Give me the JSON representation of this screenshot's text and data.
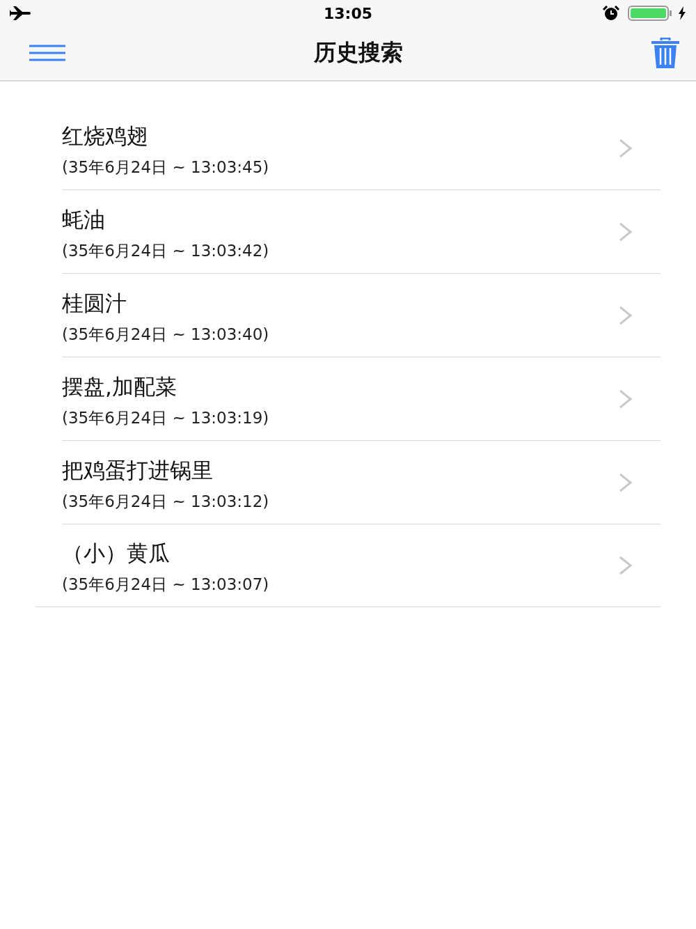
{
  "status_bar": {
    "time": "13:05"
  },
  "nav": {
    "title": "历史搜索"
  },
  "history": [
    {
      "title": "红烧鸡翅",
      "time": "(35年6月24日 ~ 13:03:45)"
    },
    {
      "title": "蚝油",
      "time": "(35年6月24日 ~ 13:03:42)"
    },
    {
      "title": "桂圆汁",
      "time": "(35年6月24日 ~ 13:03:40)"
    },
    {
      "title": "摆盘,加配菜",
      "time": "(35年6月24日 ~ 13:03:19)"
    },
    {
      "title": "把鸡蛋打进锅里",
      "time": "(35年6月24日 ~ 13:03:12)"
    },
    {
      "title": "（小）黄瓜",
      "time": "(35年6月24日 ~ 13:03:07)"
    }
  ]
}
